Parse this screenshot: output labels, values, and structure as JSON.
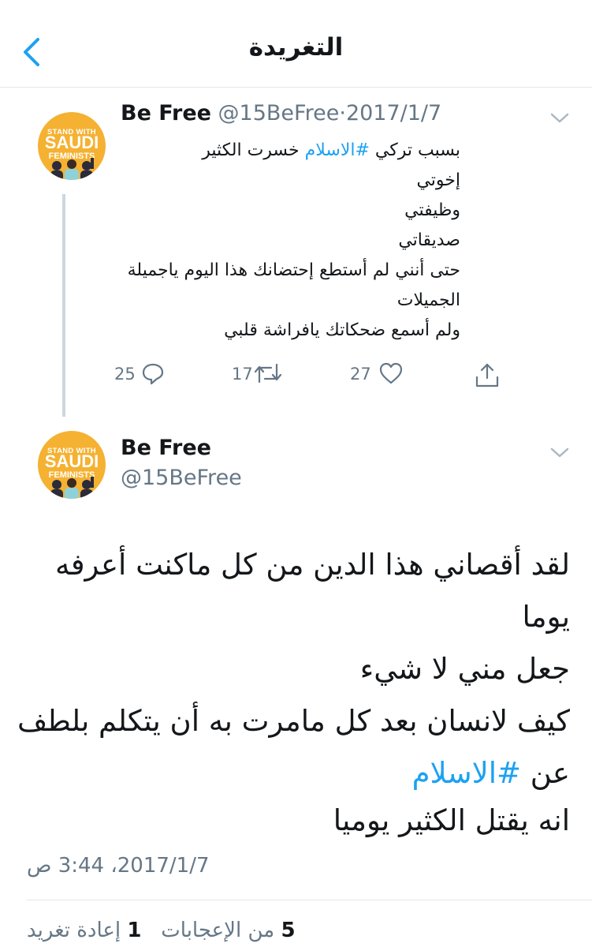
{
  "header": {
    "title": "التغريدة"
  },
  "avatar": {
    "line1": "STAND WITH",
    "line2": "SAUDI",
    "line3": "FEMINISTS"
  },
  "tweet1": {
    "name": "Be Free",
    "handle": "@15BeFree",
    "sep": "·",
    "date": "2017/1/7",
    "line1_pre": "بسبب تركي ",
    "line1_hash": "#الاسلام",
    "line1_post": " خسرت الكثير",
    "line2": "إخوتي",
    "line3": "وظيفتي",
    "line4": "صديقاتي",
    "line5": "حتى أنني لم أستطع إحتضانك هذا اليوم ياجميلة",
    "line6": "الجميلات",
    "line7": "ولم أسمع ضحكاتك يافراشة قلبي",
    "replies": "25",
    "retweets": "17",
    "likes": "27",
    "icons": [
      "reply-icon",
      "retweet-icon",
      "like-icon",
      "share-icon"
    ]
  },
  "tweet2": {
    "name": "Be Free",
    "handle": "@15BeFree",
    "line1": "لقد أقصاني هذا الدين من كل ماكنت أعرفه",
    "line2": "يوما",
    "line3": "جعل مني لا شيء",
    "line4": "كيف لانسان بعد كل مامرت به أن يتكلم بلطف",
    "line5_pre": "عن ",
    "line5_hash": "#الاسلام",
    "line6": "انه يقتل الكثير يوميا",
    "timestamp": "2017/1/7، 3:44 ص",
    "likes_count": "5",
    "likes_label": "من الإعجابات",
    "retweets_count": "1",
    "retweets_label": "إعادة تغريد"
  },
  "colors": {
    "accent": "#1da1f2",
    "muted": "#657786",
    "avatar_bg": "#f5b131"
  }
}
